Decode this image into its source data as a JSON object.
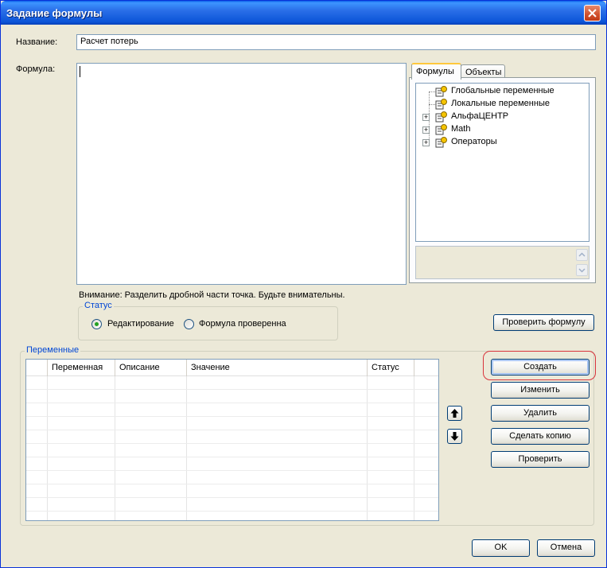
{
  "window": {
    "title": "Задание формулы"
  },
  "form": {
    "name_label": "Название:",
    "name_value": "Расчет потерь",
    "formula_label": "Формула:",
    "formula_value": "",
    "warning": "Внимание: Разделить дробной части точка. Будьте внимательны."
  },
  "tabs": [
    {
      "label": "Формулы",
      "active": true
    },
    {
      "label": "Объекты",
      "active": false
    }
  ],
  "tree": [
    {
      "label": "Глобальные переменные",
      "expandable": false
    },
    {
      "label": "Локальные переменные",
      "expandable": false
    },
    {
      "label": "АльфаЦЕНТР",
      "expandable": true
    },
    {
      "label": "Math",
      "expandable": true
    },
    {
      "label": "Операторы",
      "expandable": true
    }
  ],
  "status": {
    "title": "Статус",
    "options": [
      {
        "label": "Редактирование",
        "selected": true
      },
      {
        "label": "Формула проверенна",
        "selected": false
      }
    ]
  },
  "check_formula_button": "Проверить формулу",
  "variables": {
    "title": "Переменные",
    "columns": [
      "",
      "Переменная",
      "Описание",
      "Значение",
      "Статус"
    ],
    "rows": []
  },
  "side_buttons": {
    "create": "Создать",
    "edit": "Изменить",
    "delete": "Удалить",
    "copy": "Сделать копию",
    "check": "Проверить"
  },
  "footer": {
    "ok": "OK",
    "cancel": "Отмена"
  },
  "colors": {
    "titlebar": "#0c55d8",
    "highlight_ring": "#d9343c",
    "radio_selected": "#21a121",
    "group_title": "#0046d5"
  }
}
